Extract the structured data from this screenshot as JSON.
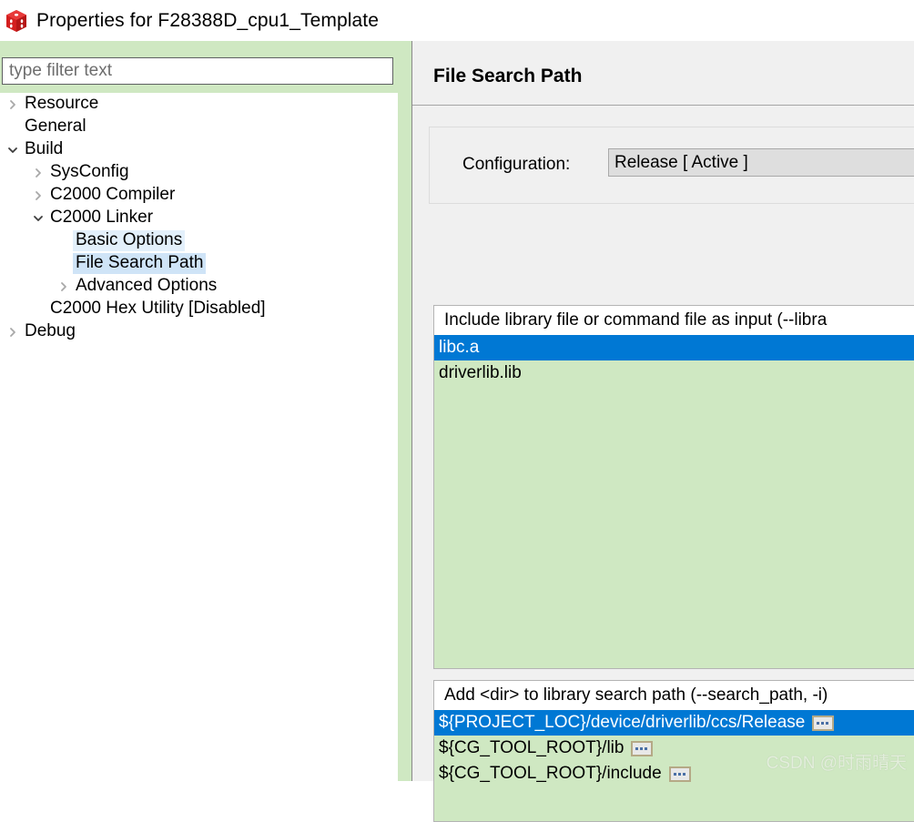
{
  "window": {
    "title": "Properties for F28388D_cpu1_Template",
    "icon": "cube-icon"
  },
  "sidebar": {
    "filter": {
      "value": "",
      "placeholder": "type filter text"
    },
    "items": [
      {
        "label": "Resource",
        "indent": 0,
        "twisty": "collapsed",
        "state": "normal"
      },
      {
        "label": "General",
        "indent": 0,
        "twisty": "none",
        "state": "normal"
      },
      {
        "label": "Build",
        "indent": 0,
        "twisty": "expanded",
        "state": "normal"
      },
      {
        "label": "SysConfig",
        "indent": 1,
        "twisty": "collapsed",
        "state": "normal"
      },
      {
        "label": "C2000 Compiler",
        "indent": 1,
        "twisty": "collapsed",
        "state": "normal"
      },
      {
        "label": "C2000 Linker",
        "indent": 1,
        "twisty": "expanded",
        "state": "normal"
      },
      {
        "label": "Basic Options",
        "indent": 2,
        "twisty": "none",
        "state": "sel-weak"
      },
      {
        "label": "File Search Path",
        "indent": 2,
        "twisty": "none",
        "state": "sel-strong"
      },
      {
        "label": "Advanced Options",
        "indent": 2,
        "twisty": "collapsed",
        "state": "normal"
      },
      {
        "label": "C2000 Hex Utility  [Disabled]",
        "indent": 1,
        "twisty": "none",
        "state": "normal"
      },
      {
        "label": "Debug",
        "indent": 0,
        "twisty": "collapsed",
        "state": "normal"
      }
    ]
  },
  "main": {
    "title": "File Search Path",
    "configuration": {
      "label": "Configuration:",
      "value": "Release  [ Active ]"
    },
    "libraries": {
      "header": "Include library file or command file as input (--libra",
      "items": [
        {
          "text": "libc.a",
          "selected": true,
          "has_browse_button": false
        },
        {
          "text": "driverlib.lib",
          "selected": false,
          "has_browse_button": false
        }
      ]
    },
    "search_paths": {
      "header": "Add <dir> to library search path (--search_path, -i)",
      "items": [
        {
          "text": "${PROJECT_LOC}/device/driverlib/ccs/Release",
          "selected": true,
          "has_browse_button": true
        },
        {
          "text": "${CG_TOOL_ROOT}/lib",
          "selected": false,
          "has_browse_button": true
        },
        {
          "text": "${CG_TOOL_ROOT}/include",
          "selected": false,
          "has_browse_button": true
        }
      ]
    }
  },
  "watermark": "CSDN @时雨晴天",
  "colors": {
    "accent_selection": "#0078d4",
    "panel_green": "#cfe8c2",
    "panel_gray": "#f0f0f0",
    "tree_sel_weak": "#e3f0fb",
    "tree_sel_strong": "#cfe4f7"
  }
}
